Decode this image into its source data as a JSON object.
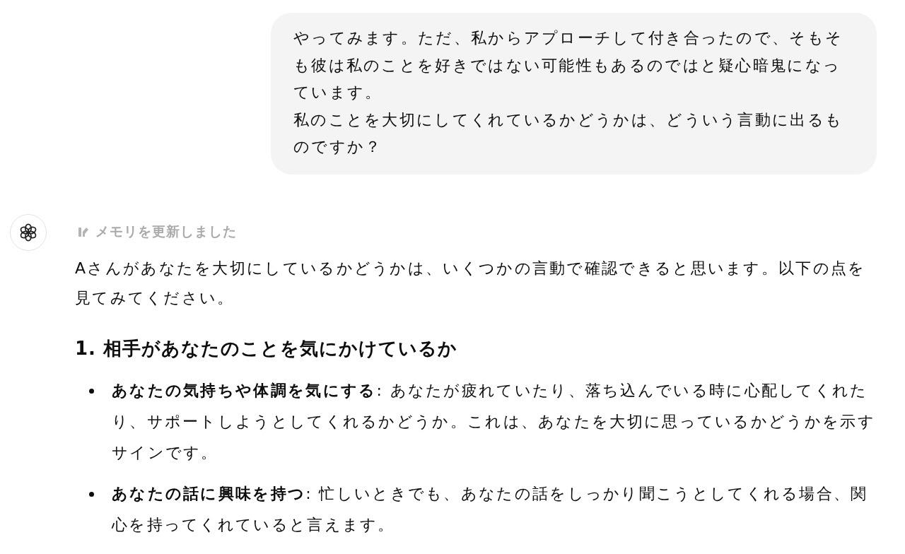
{
  "user_message": {
    "paragraphs": [
      "やってみます。ただ、私からアプローチして付き合ったので、そもそも彼は私のことを好きではない可能性もあるのではと疑心暗鬼になっています。",
      "私のことを大切にしてくれているかどうかは、どういう言動に出るものですか？"
    ]
  },
  "assistant": {
    "memory_note": "メモリを更新しました",
    "intro": "Aさんがあなたを大切にしているかどうかは、いくつかの言動で確認できると思います。以下の点を見てみてください。",
    "sections": [
      {
        "heading": "1. 相手があなたのことを気にかけているか",
        "bullets": [
          "**あなたの気持ちや体調を気にする**: あなたが疲れていたり、落ち込んでいる時に心配してくれたり、サポートしようとしてくれるかどうか。これは、あなたを大切に思っているかどうかを示すサインです。",
          "**あなたの話に興味を持つ**: 忙しいときでも、あなたの話をしっかり聞こうとしてくれる場合、関心を持ってくれていると言えます。"
        ]
      }
    ]
  }
}
